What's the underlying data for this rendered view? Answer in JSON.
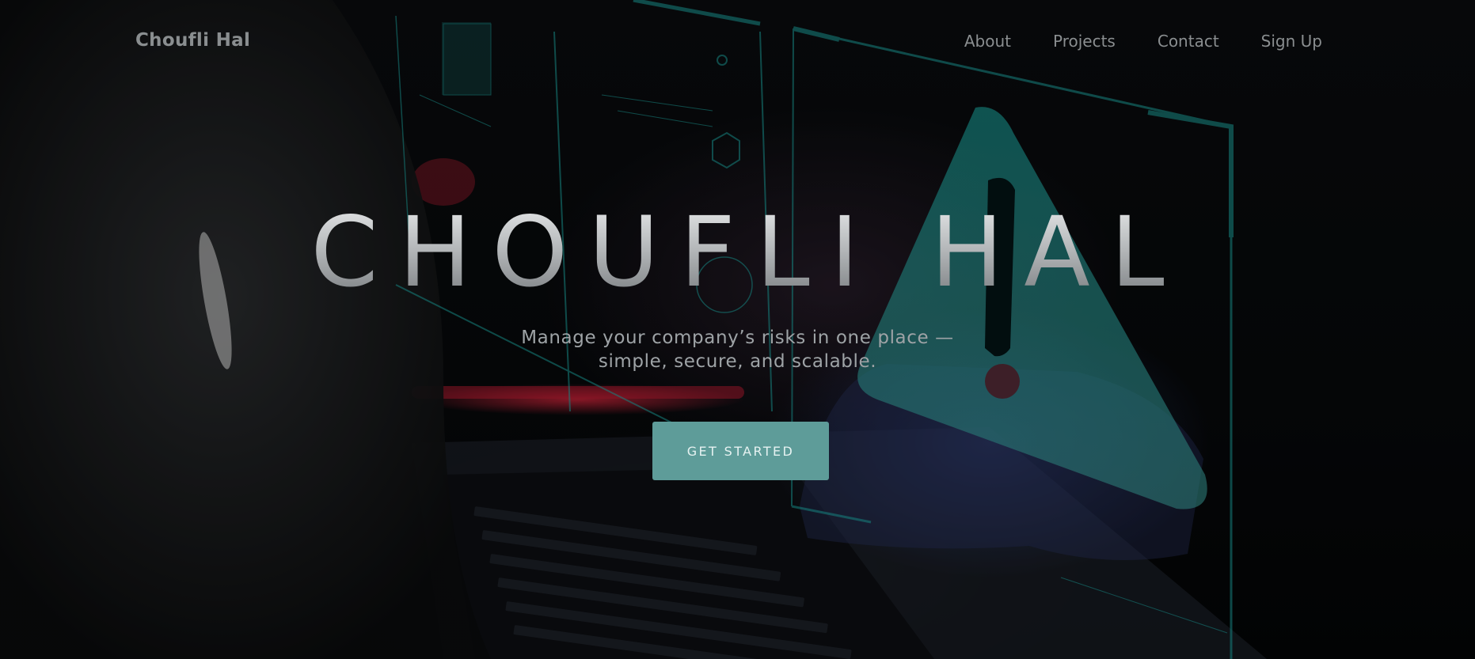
{
  "nav": {
    "brand": "Choufli Hal",
    "links": [
      "About",
      "Projects",
      "Contact",
      "Sign Up"
    ]
  },
  "hero": {
    "title": "CHOUFLI HAL",
    "subtitle_line1": "Manage your company’s risks in one place —",
    "subtitle_line2": "simple, secure, and scalable.",
    "cta_label": "GET STARTED",
    "background_icon": "warning-triangle-icon"
  },
  "colors": {
    "accent": "#5e9c99",
    "hologram": "#1fb5b0",
    "nav_text": "#8a8e90",
    "background": "#050607"
  }
}
